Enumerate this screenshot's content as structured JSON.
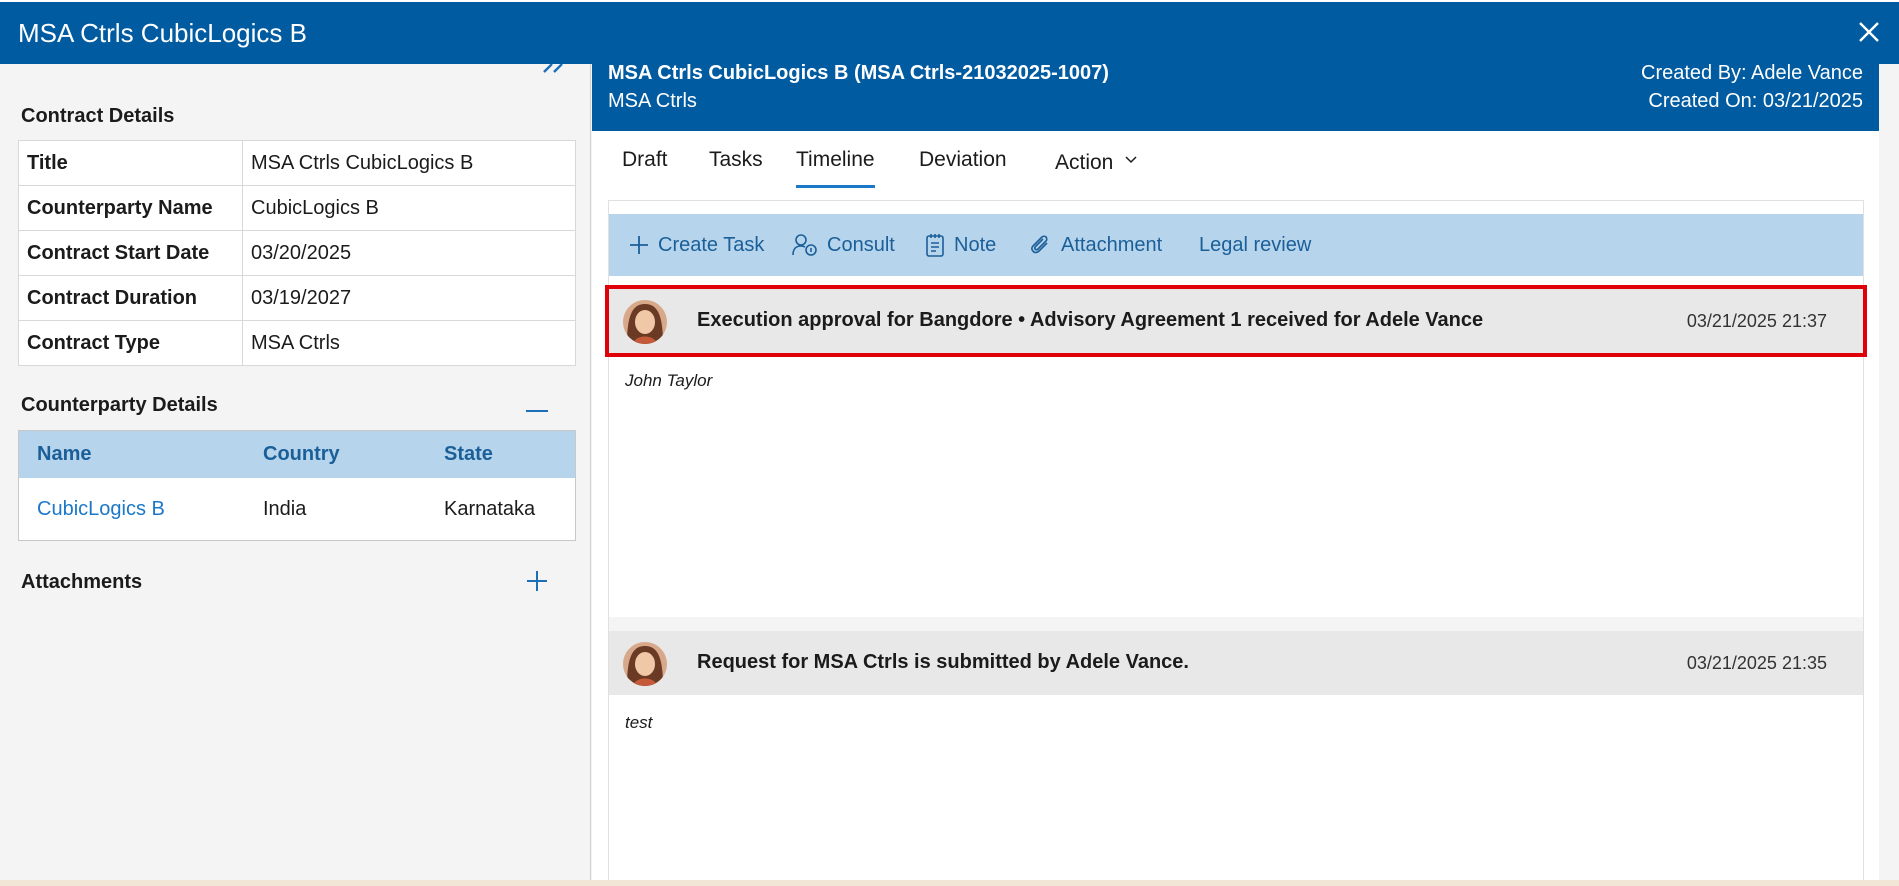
{
  "window": {
    "title": "MSA Ctrls CubicLogics B"
  },
  "left": {
    "contract_details_title": "Contract Details",
    "details": [
      {
        "key": "Title",
        "value": "MSA Ctrls CubicLogics B"
      },
      {
        "key": "Counterparty Name",
        "value": "CubicLogics B"
      },
      {
        "key": "Contract Start Date",
        "value": "03/20/2025"
      },
      {
        "key": "Contract Duration",
        "value": "03/19/2027"
      },
      {
        "key": "Contract Type",
        "value": "MSA Ctrls"
      }
    ],
    "counterparty_title": "Counterparty Details",
    "counterparty_headers": {
      "name": "Name",
      "country": "Country",
      "state": "State"
    },
    "counterparty_row": {
      "name": "CubicLogics B",
      "country": "India",
      "state": "Karnataka"
    },
    "attachments_title": "Attachments"
  },
  "header": {
    "contract_title": "MSA Ctrls CubicLogics B (MSA Ctrls-21032025-1007)",
    "contract_type": "MSA Ctrls",
    "created_by": "Created By: Adele Vance",
    "created_on": "Created On: 03/21/2025"
  },
  "tabs": {
    "draft": "Draft",
    "tasks": "Tasks",
    "timeline": "Timeline",
    "deviation": "Deviation",
    "action": "Action"
  },
  "toolbar": {
    "create_task": "Create Task",
    "consult": "Consult",
    "note": "Note",
    "attachment": "Attachment",
    "legal_review": "Legal review"
  },
  "timeline": [
    {
      "title": "Execution approval for Bangdore • Advisory Agreement 1 received for Adele Vance",
      "time": "03/21/2025 21:37",
      "note": "John Taylor"
    },
    {
      "title": "Request for MSA Ctrls is submitted by Adele Vance.",
      "time": "03/21/2025 21:35",
      "note": "test"
    }
  ],
  "colors": {
    "brand": "#005ba1",
    "toolbar": "#b6d4ec",
    "highlight": "#e0000a",
    "link": "#1b78c8"
  }
}
